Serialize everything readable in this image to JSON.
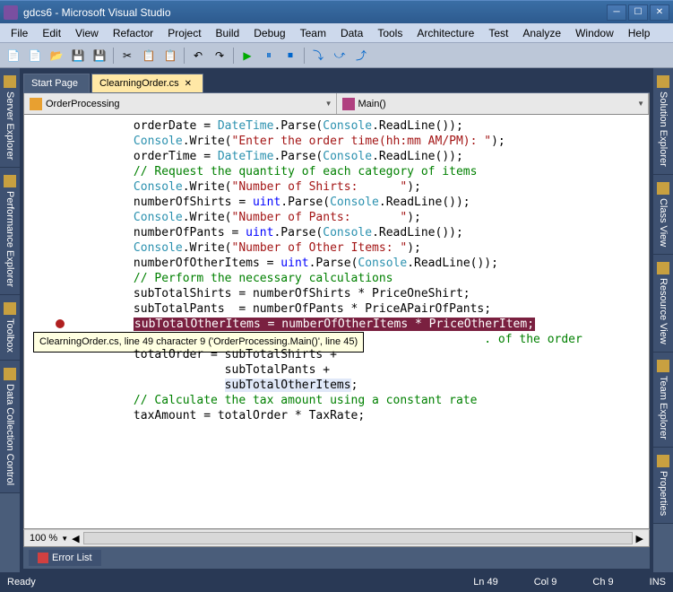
{
  "window": {
    "title": "gdcs6 - Microsoft Visual Studio"
  },
  "menu": [
    "File",
    "Edit",
    "View",
    "Refactor",
    "Project",
    "Build",
    "Debug",
    "Team",
    "Data",
    "Tools",
    "Architecture",
    "Test",
    "Analyze",
    "Window",
    "Help"
  ],
  "left_tabs": [
    "Server Explorer",
    "Performance Explorer",
    "Toolbox",
    "Data Collection Control"
  ],
  "right_tabs": [
    "Solution Explorer",
    "Class View",
    "Resource View",
    "Team Explorer",
    "Properties"
  ],
  "tabs": [
    {
      "label": "Start Page",
      "active": false
    },
    {
      "label": "ClearningOrder.cs",
      "active": true
    }
  ],
  "nav": {
    "left": "OrderProcessing",
    "right": "Main()"
  },
  "code_lines": [
    {
      "indent": 3,
      "tokens": [
        {
          "t": "orderDate = "
        },
        {
          "t": "DateTime",
          "c": "c-type"
        },
        {
          "t": ".Parse("
        },
        {
          "t": "Console",
          "c": "c-type"
        },
        {
          "t": ".ReadLine());"
        }
      ]
    },
    {
      "indent": 3,
      "tokens": [
        {
          "t": "Console",
          "c": "c-type"
        },
        {
          "t": ".Write("
        },
        {
          "t": "\"Enter the order time(hh:mm AM/PM): \"",
          "c": "c-str"
        },
        {
          "t": ");"
        }
      ]
    },
    {
      "indent": 3,
      "tokens": [
        {
          "t": "orderTime = "
        },
        {
          "t": "DateTime",
          "c": "c-type"
        },
        {
          "t": ".Parse("
        },
        {
          "t": "Console",
          "c": "c-type"
        },
        {
          "t": ".ReadLine());"
        }
      ]
    },
    {
      "indent": 0,
      "tokens": []
    },
    {
      "indent": 3,
      "tokens": [
        {
          "t": "// Request the quantity of each category of items",
          "c": "c-cmt"
        }
      ]
    },
    {
      "indent": 3,
      "tokens": [
        {
          "t": "Console",
          "c": "c-type"
        },
        {
          "t": ".Write("
        },
        {
          "t": "\"Number of Shirts:      \"",
          "c": "c-str"
        },
        {
          "t": ");"
        }
      ]
    },
    {
      "indent": 3,
      "tokens": [
        {
          "t": "numberOfShirts = "
        },
        {
          "t": "uint",
          "c": "c-kw"
        },
        {
          "t": ".Parse("
        },
        {
          "t": "Console",
          "c": "c-type"
        },
        {
          "t": ".ReadLine());"
        }
      ]
    },
    {
      "indent": 0,
      "tokens": []
    },
    {
      "indent": 3,
      "tokens": [
        {
          "t": "Console",
          "c": "c-type"
        },
        {
          "t": ".Write("
        },
        {
          "t": "\"Number of Pants:       \"",
          "c": "c-str"
        },
        {
          "t": ");"
        }
      ]
    },
    {
      "indent": 3,
      "tokens": [
        {
          "t": "numberOfPants = "
        },
        {
          "t": "uint",
          "c": "c-kw"
        },
        {
          "t": ".Parse("
        },
        {
          "t": "Console",
          "c": "c-type"
        },
        {
          "t": ".ReadLine());"
        }
      ]
    },
    {
      "indent": 0,
      "tokens": []
    },
    {
      "indent": 3,
      "tokens": [
        {
          "t": "Console",
          "c": "c-type"
        },
        {
          "t": ".Write("
        },
        {
          "t": "\"Number of Other Items: \"",
          "c": "c-str"
        },
        {
          "t": ");"
        }
      ]
    },
    {
      "indent": 3,
      "tokens": [
        {
          "t": "numberOfOtherItems = "
        },
        {
          "t": "uint",
          "c": "c-kw"
        },
        {
          "t": ".Parse("
        },
        {
          "t": "Console",
          "c": "c-type"
        },
        {
          "t": ".ReadLine());"
        }
      ]
    },
    {
      "indent": 0,
      "tokens": []
    },
    {
      "indent": 3,
      "tokens": [
        {
          "t": "// Perform the necessary calculations",
          "c": "c-cmt"
        }
      ]
    },
    {
      "indent": 3,
      "tokens": [
        {
          "t": "subTotalShirts = numberOfShirts * PriceOneShirt;"
        }
      ]
    },
    {
      "indent": 3,
      "tokens": [
        {
          "t": "subTotalPants  = numberOfPants * PriceAPairOfPants;"
        }
      ]
    },
    {
      "indent": 3,
      "tokens": [
        {
          "t": "subTotalOtherItems = numberOfOtherItems * PriceOtherItem;",
          "c": "c-hl"
        }
      ],
      "breakpoint": true
    },
    {
      "indent": 3,
      "tooltip": "ClearningOrder.cs, line 49 character 9 ('OrderProcessing.Main()', line 45)",
      "tokens": [
        {
          "t": "                                                  "
        },
        {
          "t": ". of the order",
          "c": "c-cmt"
        }
      ]
    },
    {
      "indent": 3,
      "tokens": [
        {
          "t": "totalOrder = subTotalShirts +"
        }
      ]
    },
    {
      "indent": 3,
      "tokens": [
        {
          "t": "             subTotalPants +"
        }
      ]
    },
    {
      "indent": 3,
      "tokens": [
        {
          "t": "             "
        },
        {
          "t": "subTotalOtherItems",
          "c": "c-hl2"
        },
        {
          "t": ";"
        }
      ]
    },
    {
      "indent": 0,
      "tokens": []
    },
    {
      "indent": 3,
      "tokens": [
        {
          "t": "// Calculate the tax amount using a constant rate",
          "c": "c-cmt"
        }
      ]
    },
    {
      "indent": 3,
      "tokens": [
        {
          "t": "taxAmount = totalOrder * TaxRate;"
        }
      ]
    }
  ],
  "zoom": "100 %",
  "error_list_label": "Error List",
  "status": {
    "ready": "Ready",
    "ln": "Ln 49",
    "col": "Col 9",
    "ch": "Ch 9",
    "ins": "INS"
  }
}
